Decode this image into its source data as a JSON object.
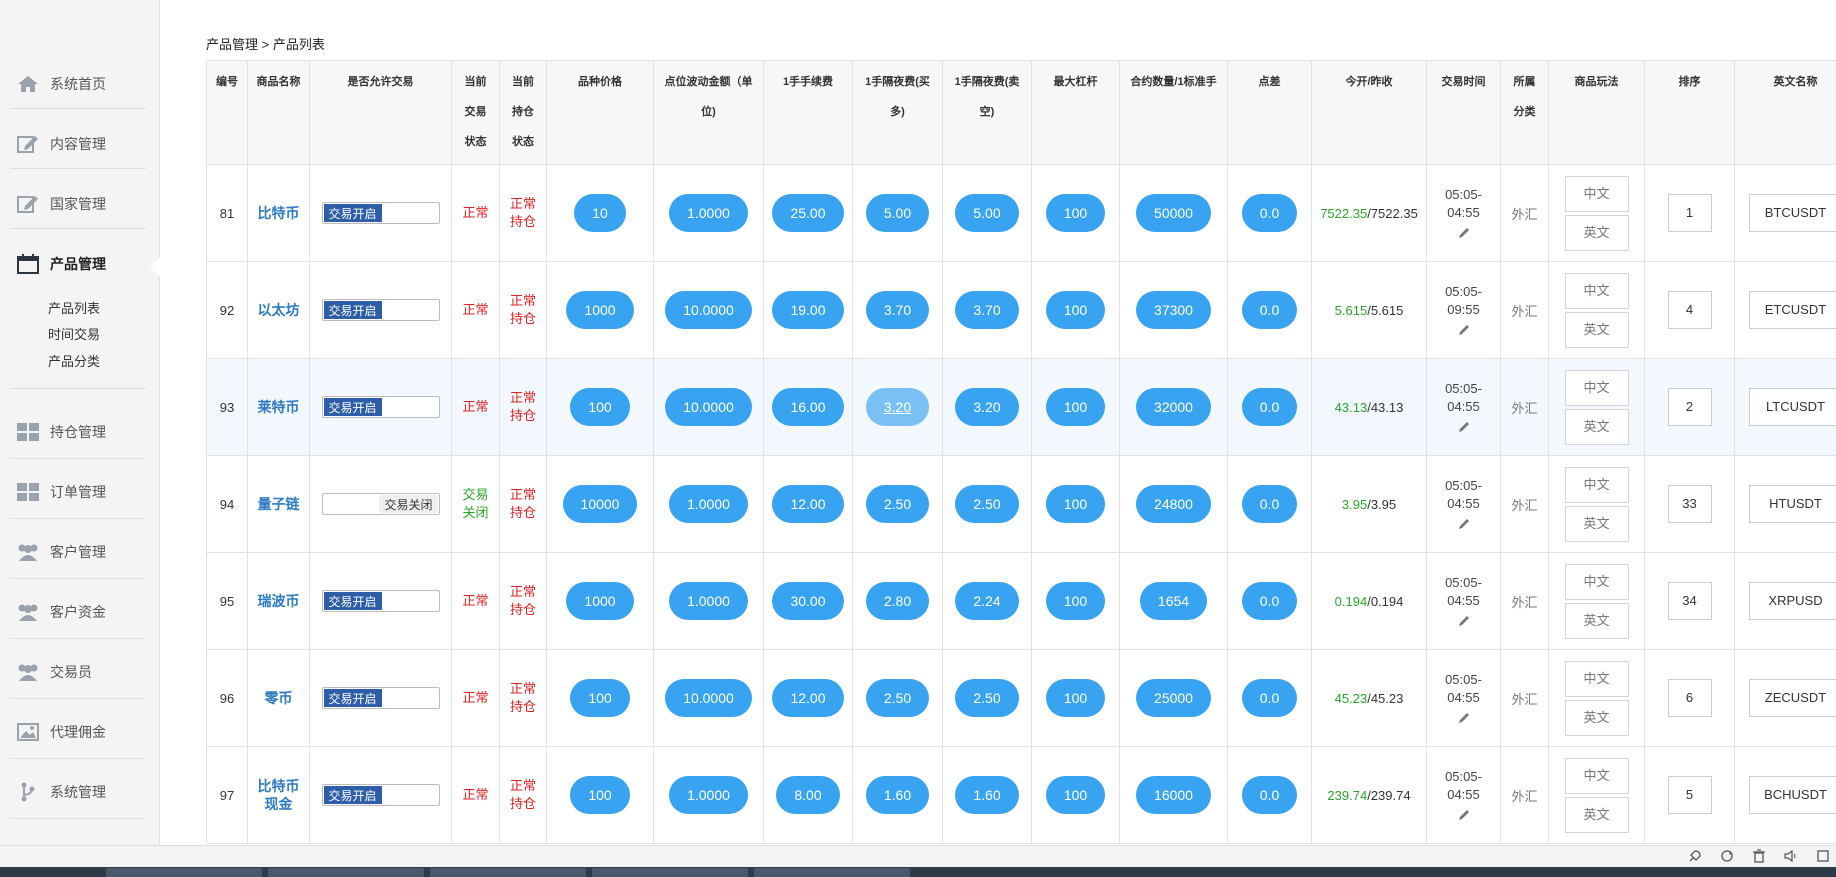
{
  "sidebar": {
    "items": [
      {
        "label": "系统首页",
        "icon": "home-icon"
      },
      {
        "label": "内容管理",
        "icon": "edit-icon"
      },
      {
        "label": "国家管理",
        "icon": "edit-icon"
      },
      {
        "label": "产品管理",
        "icon": "calendar-icon"
      },
      {
        "label": "持仓管理",
        "icon": "grid-icon"
      },
      {
        "label": "订单管理",
        "icon": "grid-icon"
      },
      {
        "label": "客户管理",
        "icon": "users-icon"
      },
      {
        "label": "客户资金",
        "icon": "users-icon"
      },
      {
        "label": "交易员",
        "icon": "users-icon"
      },
      {
        "label": "代理佣金",
        "icon": "image-icon"
      },
      {
        "label": "系统管理",
        "icon": "branch-icon"
      }
    ],
    "submenu": [
      "产品列表",
      "时间交易",
      "产品分类"
    ]
  },
  "breadcrumb": "产品管理 > 产品列表",
  "columns": [
    "编号",
    "商品名称",
    "是否允许交易",
    "当前交易状态",
    "当前持仓状态",
    "品种价格",
    "点位波动金额（单位）",
    "1手手续费",
    "1手隔夜费(买多)",
    "1手隔夜费(卖空)",
    "最大杠杆",
    "合约数量/1标准手",
    "点差",
    "今开/昨收",
    "交易时间",
    "所属分类",
    "商品玩法",
    "排序",
    "英文名称"
  ],
  "header_lines": {
    "col3": [
      "当前",
      "交易",
      "状态"
    ],
    "col4": [
      "当前",
      "持仓",
      "状态"
    ],
    "col6": [
      "点位波动金额（单",
      "位)"
    ],
    "col8": [
      "1手隔夜费(买",
      "多)"
    ],
    "col9": [
      "1手隔夜费(卖",
      "空)"
    ],
    "col15": [
      "所属",
      "分类"
    ]
  },
  "labels": {
    "toggle_on": "交易开启",
    "toggle_off": "交易关闭",
    "lang_cn": "中文",
    "lang_en": "英文",
    "category": "外汇"
  },
  "rows": [
    {
      "id": "81",
      "name": [
        "比特币"
      ],
      "trade_on": true,
      "trade_status": [
        "正常"
      ],
      "hold_status": [
        "正常",
        "持仓"
      ],
      "price": "10",
      "point": "1.0000",
      "fee": "25.00",
      "buy": "5.00",
      "sell": "5.00",
      "leverage": "100",
      "contract": "50000",
      "spread": "0.0",
      "open": "7522.35",
      "close": "7522.35",
      "time": [
        "05:05-",
        "04:55"
      ],
      "sort": "1",
      "en": "BTCUSDT"
    },
    {
      "id": "92",
      "name": [
        "以太坊"
      ],
      "trade_on": true,
      "trade_status": [
        "正常"
      ],
      "hold_status": [
        "正常",
        "持仓"
      ],
      "price": "1000",
      "point": "10.0000",
      "fee": "19.00",
      "buy": "3.70",
      "sell": "3.70",
      "leverage": "100",
      "contract": "37300",
      "spread": "0.0",
      "open": "5.615",
      "close": "5.615",
      "time": [
        "05:05-",
        "09:55"
      ],
      "sort": "4",
      "en": "ETCUSDT"
    },
    {
      "id": "93",
      "name": [
        "莱特币"
      ],
      "trade_on": true,
      "trade_status": [
        "正常"
      ],
      "hold_status": [
        "正常",
        "持仓"
      ],
      "price": "100",
      "point": "10.0000",
      "fee": "16.00",
      "buy": "3.20",
      "sell": "3.20",
      "leverage": "100",
      "contract": "32000",
      "spread": "0.0",
      "open": "43.13",
      "close": "43.13",
      "time": [
        "05:05-",
        "04:55"
      ],
      "sort": "2",
      "en": "LTCUSDT"
    },
    {
      "id": "94",
      "name": [
        "量子链"
      ],
      "trade_on": false,
      "trade_status": [
        "交易",
        "关闭"
      ],
      "hold_status": [
        "正常",
        "持仓"
      ],
      "price": "10000",
      "point": "1.0000",
      "fee": "12.00",
      "buy": "2.50",
      "sell": "2.50",
      "leverage": "100",
      "contract": "24800",
      "spread": "0.0",
      "open": "3.95",
      "close": "3.95",
      "time": [
        "05:05-",
        "04:55"
      ],
      "sort": "33",
      "en": "HTUSDT"
    },
    {
      "id": "95",
      "name": [
        "瑞波币"
      ],
      "trade_on": true,
      "trade_status": [
        "正常"
      ],
      "hold_status": [
        "正常",
        "持仓"
      ],
      "price": "1000",
      "point": "1.0000",
      "fee": "30.00",
      "buy": "2.80",
      "sell": "2.24",
      "leverage": "100",
      "contract": "1654",
      "spread": "0.0",
      "open": "0.194",
      "close": "0.194",
      "time": [
        "05:05-",
        "04:55"
      ],
      "sort": "34",
      "en": "XRPUSD"
    },
    {
      "id": "96",
      "name": [
        "零币"
      ],
      "trade_on": true,
      "trade_status": [
        "正常"
      ],
      "hold_status": [
        "正常",
        "持仓"
      ],
      "price": "100",
      "point": "10.0000",
      "fee": "12.00",
      "buy": "2.50",
      "sell": "2.50",
      "leverage": "100",
      "contract": "25000",
      "spread": "0.0",
      "open": "45.23",
      "close": "45.23",
      "time": [
        "05:05-",
        "04:55"
      ],
      "sort": "6",
      "en": "ZECUSDT"
    },
    {
      "id": "97",
      "name": [
        "比特币",
        "现金"
      ],
      "trade_on": true,
      "trade_status": [
        "正常"
      ],
      "hold_status": [
        "正常",
        "持仓"
      ],
      "price": "100",
      "point": "1.0000",
      "fee": "8.00",
      "buy": "1.60",
      "sell": "1.60",
      "leverage": "100",
      "contract": "16000",
      "spread": "0.0",
      "open": "239.74",
      "close": "239.74",
      "time": [
        "05:05-",
        "04:55"
      ],
      "sort": "5",
      "en": "BCHUSDT"
    }
  ],
  "colors": {
    "accent": "#37a3f1",
    "link": "#2f7bc1",
    "danger": "#e02020",
    "success": "#2aa42a",
    "toggle": "#2f5ea8"
  }
}
